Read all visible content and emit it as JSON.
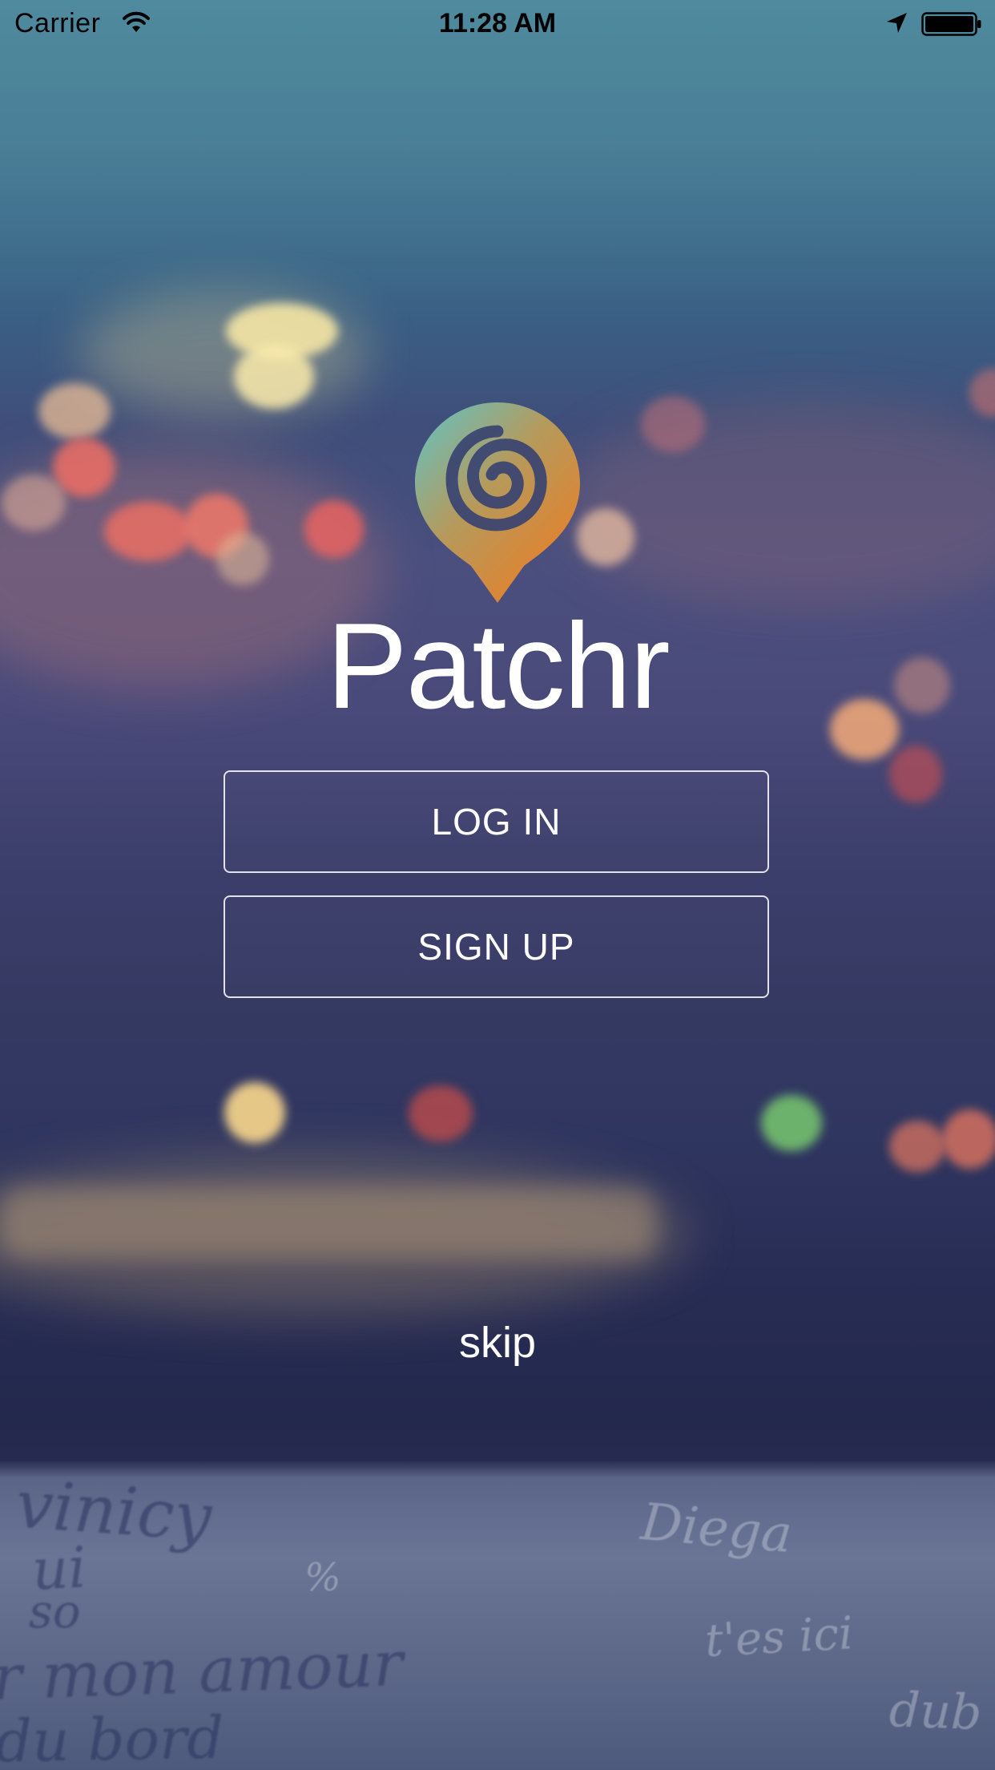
{
  "status_bar": {
    "carrier": "Carrier",
    "time": "11:28 AM"
  },
  "app": {
    "name": "Patchr",
    "logo_colors": {
      "teal": "#5fc4c8",
      "orange": "#f07b1f"
    }
  },
  "actions": {
    "login_label": "LOG IN",
    "signup_label": "SIGN UP",
    "skip_label": "skip"
  },
  "icons": {
    "wifi": "wifi-icon",
    "location": "location-arrow-icon",
    "battery": "battery-icon",
    "logo": "patchr-spiral-pin-logo"
  }
}
